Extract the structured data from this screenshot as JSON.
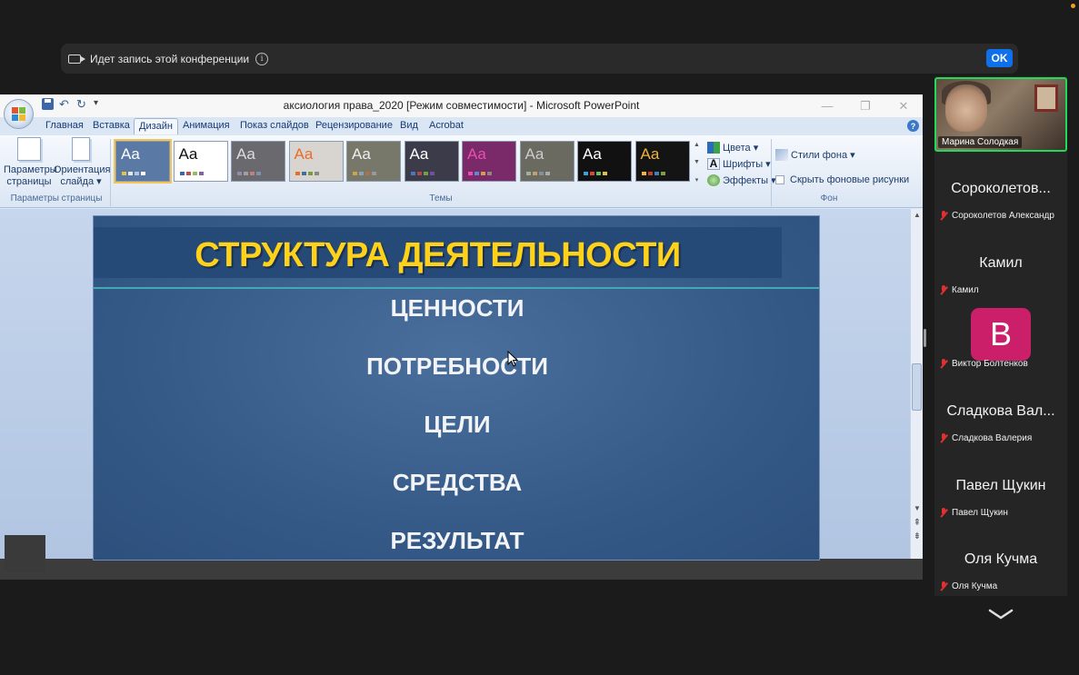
{
  "banner": {
    "text": "Идет запись этой конференции",
    "ok_label": "OK",
    "info_glyph": "i"
  },
  "ppt": {
    "title": "аксиология права_2020 [Режим совместимости] - Microsoft PowerPoint",
    "tabs": [
      "Главная",
      "Вставка",
      "Дизайн",
      "Анимация",
      "Показ слайдов",
      "Рецензирование",
      "Вид",
      "Acrobat"
    ],
    "active_tab": "Дизайн",
    "ribbon": {
      "page_setup_btn": [
        "Параметры",
        "страницы"
      ],
      "orientation_btn": [
        "Ориентация",
        "слайда ▾"
      ],
      "group_page": "Параметры страницы",
      "group_themes": "Темы",
      "group_bg": "Фон",
      "theme_label": "Aa",
      "colors": "Цвета ▾",
      "fonts": "Шрифты ▾",
      "effects": "Эффекты ▾",
      "bg_styles": "Стили фона ▾",
      "hide_bg": "Скрыть фоновые рисунки"
    },
    "themes": [
      {
        "bg": "#5a7aa5",
        "fg": "#ffffff",
        "sw": [
          "#e8c04a",
          "#e6e6e6",
          "#b0c6e6",
          "#fff"
        ]
      },
      {
        "bg": "#ffffff",
        "fg": "#111111",
        "sw": [
          "#3a66b0",
          "#c0504d",
          "#9bbb59",
          "#8064a2"
        ]
      },
      {
        "bg": "#6a6a6e",
        "fg": "#dddddd",
        "sw": [
          "#8b8fb0",
          "#a0a0a0",
          "#c08080",
          "#8090b0"
        ]
      },
      {
        "bg": "#d8d4d0",
        "fg": "#e86d2a",
        "sw": [
          "#e86d2a",
          "#3c6ea8",
          "#7a9b3a",
          "#888"
        ]
      },
      {
        "bg": "#77776a",
        "fg": "#eeeeee",
        "sw": [
          "#c8a64a",
          "#8aa0b8",
          "#b07050",
          "#999"
        ]
      },
      {
        "bg": "#3b3b4a",
        "fg": "#ffffff",
        "sw": [
          "#4a78c0",
          "#b04848",
          "#70a040",
          "#7050a0"
        ]
      },
      {
        "bg": "#7a2a68",
        "fg": "#e84fb0",
        "sw": [
          "#e84fb0",
          "#5a8ad0",
          "#d0a040",
          "#888"
        ]
      },
      {
        "bg": "#6a6a60",
        "fg": "#cccccc",
        "sw": [
          "#a0b0a0",
          "#c0a070",
          "#8090a0",
          "#aaa"
        ]
      },
      {
        "bg": "#111111",
        "fg": "#ffffff",
        "sw": [
          "#3aa0e0",
          "#e04040",
          "#60c060",
          "#e0c040"
        ]
      },
      {
        "bg": "#141414",
        "fg": "#f0b43c",
        "sw": [
          "#f0b43c",
          "#c04030",
          "#4080c0",
          "#80a040"
        ]
      }
    ],
    "colors": {
      "accent_blue": "#153b76"
    }
  },
  "slide": {
    "title": "СТРУКТУРА ДЕЯТЕЛЬНОСТИ",
    "items": [
      "ЦЕННОСТИ",
      "ПОТРЕБНОСТИ",
      "ЦЕЛИ",
      "СРЕДСТВА",
      "РЕЗУЛЬТАТ"
    ],
    "title_color": "#ffd21a"
  },
  "participants": {
    "active_speaker": "Марина Солодкая",
    "list": [
      {
        "display": "Сороколетов...",
        "name": "Сороколетов Александр"
      },
      {
        "display": "Камил",
        "name": "Камил"
      },
      {
        "display": "В",
        "name": "Виктор Болтенков"
      },
      {
        "display": "Сладкова Вал...",
        "name": "Сладкова Валерия"
      },
      {
        "display": "Павел Щукин",
        "name": "Павел Щукин"
      },
      {
        "display": "Оля Кучма",
        "name": "Оля Кучма"
      }
    ],
    "avatar_color": "#cc1f6a",
    "active_border": "#23d959"
  }
}
